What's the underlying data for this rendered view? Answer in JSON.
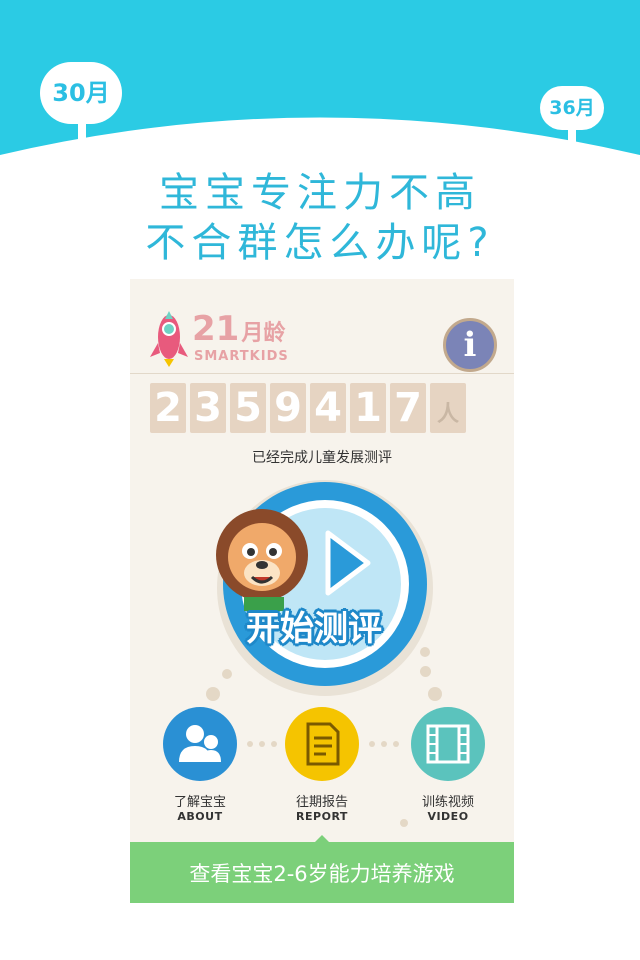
{
  "banner": {
    "month_left": "30月",
    "month_right": "36月"
  },
  "headline": {
    "line1": "宝宝专注力不高",
    "line2": "不合群怎么办呢?"
  },
  "app": {
    "age_number": "21",
    "age_unit": "月龄",
    "brand": "SMARTKIDS",
    "info_icon_glyph": "i",
    "counter_digits": [
      "2",
      "3",
      "5",
      "9",
      "4",
      "1",
      "7"
    ],
    "counter_unit": "人",
    "counter_caption": "已经完成儿童发展测评",
    "start_button_label": "开始测评",
    "nav": [
      {
        "label": "了解宝宝",
        "sub": "ABOUT",
        "icon": "people-icon",
        "color": "#2a90d4"
      },
      {
        "label": "往期报告",
        "sub": "REPORT",
        "icon": "document-icon",
        "color": "#f5c400"
      },
      {
        "label": "训练视频",
        "sub": "VIDEO",
        "icon": "film-icon",
        "color": "#5bc3bd"
      }
    ],
    "bottom_button_label": "查看宝宝2-6岁能力培养游戏"
  },
  "colors": {
    "banner": "#2bcbe4",
    "headline": "#2fb7d9",
    "start_ring": "#2a9ad9",
    "bottom_bar": "#7cd07a"
  }
}
